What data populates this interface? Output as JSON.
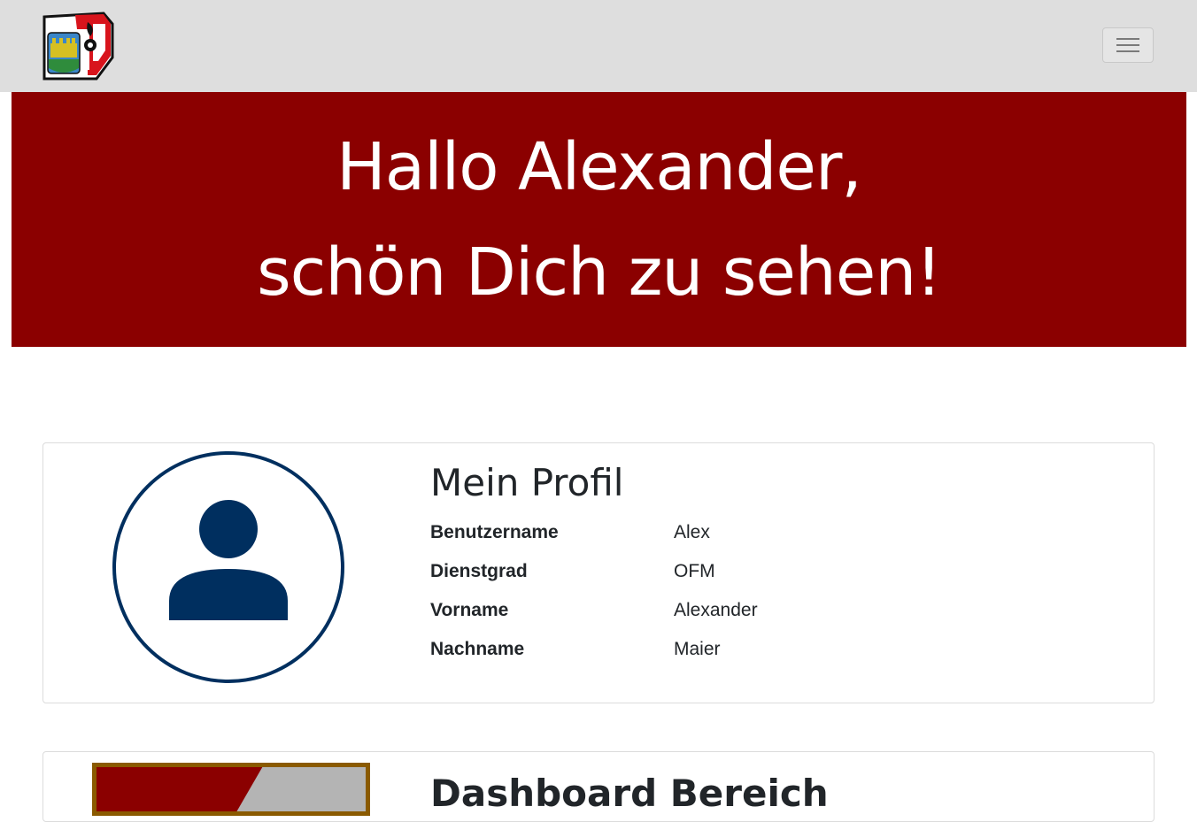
{
  "navbar": {
    "logo_name": "fire-department-logo",
    "toggler_icon": "hamburger-menu-icon"
  },
  "hero": {
    "line1": "Hallo Alexander,",
    "line2": "schön Dich zu sehen!",
    "background": "#8b0000"
  },
  "profile": {
    "title": "Mein Profil",
    "avatar_icon": "user-avatar-icon",
    "fields": [
      {
        "label": "Benutzername",
        "value": "Alex"
      },
      {
        "label": "Dienstgrad",
        "value": "OFM"
      },
      {
        "label": "Vorname",
        "value": "Alexander"
      },
      {
        "label": "Nachname",
        "value": "Maier"
      }
    ]
  },
  "second_card": {
    "title": "Dashboard Bereich"
  },
  "colors": {
    "accent": "#8b0000",
    "avatar": "#002f5f",
    "navbar": "#dedede"
  }
}
